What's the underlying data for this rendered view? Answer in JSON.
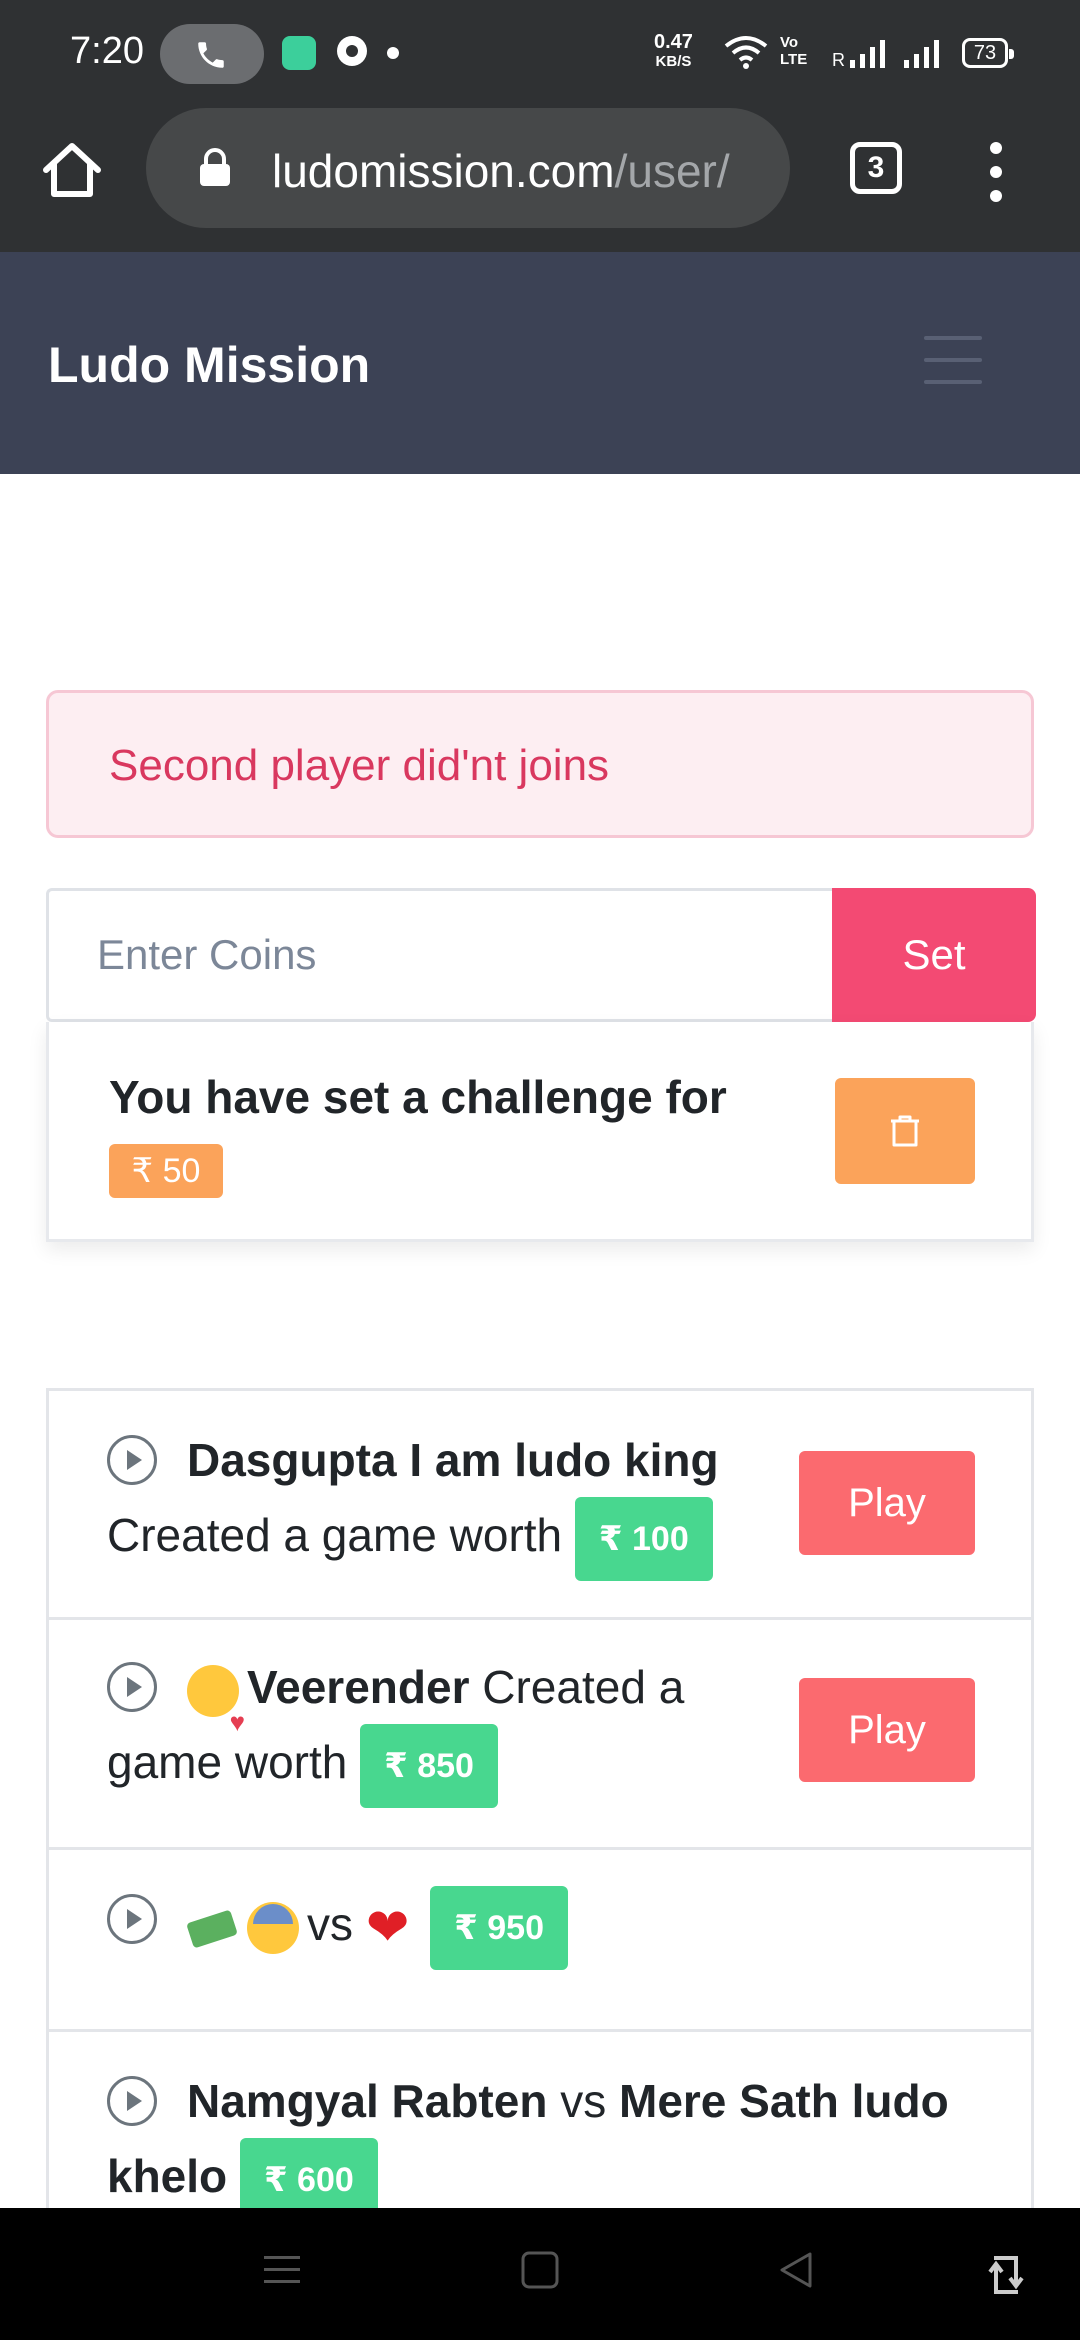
{
  "status_bar": {
    "time": "7:20",
    "speed_value": "0.47",
    "speed_unit": "KB/S",
    "volte_line1": "Vo",
    "volte_line2": "LTE",
    "signal_label": "R",
    "battery": "73"
  },
  "browser": {
    "url_domain": "ludomission.com",
    "url_path": "/user/",
    "tab_count": "3"
  },
  "navbar": {
    "brand": "Ludo Mission"
  },
  "alert": {
    "text": "Second player did'nt joins"
  },
  "challenge_form": {
    "placeholder": "Enter Coins",
    "set_label": "Set"
  },
  "my_challenge": {
    "text": "You have set a challenge for",
    "amount": "₹ 50"
  },
  "games": [
    {
      "player": "Dasgupta I am ludo king",
      "action_text": "Created a game worth",
      "amount": "₹ 100",
      "play_label": "Play"
    },
    {
      "player": "Veerender",
      "action_text": "Created a",
      "action_text2": "game worth",
      "amount": "₹ 850",
      "play_label": "Play"
    },
    {
      "vs_text": "vs",
      "amount": "₹ 950"
    },
    {
      "player1": "Namgyal Rabten",
      "vs_text": "vs",
      "player2": "Mere Sath ludo",
      "player2_cont": "khelo",
      "amount": "₹ 600"
    }
  ],
  "colors": {
    "navbar": "#3c4255",
    "set_button": "#f34a73",
    "play_button": "#fb6a6f",
    "amount_badge": "#48d78f",
    "challenge_badge": "#fba35a",
    "alert_text": "#d9385f"
  },
  "icons": [
    "home-icon",
    "lock-icon",
    "tabs-icon",
    "more-vert-icon",
    "hamburger-icon",
    "trash-icon",
    "play-circle-icon",
    "menu-nav-icon",
    "square-nav-icon",
    "back-nav-icon",
    "rotate-icon"
  ]
}
